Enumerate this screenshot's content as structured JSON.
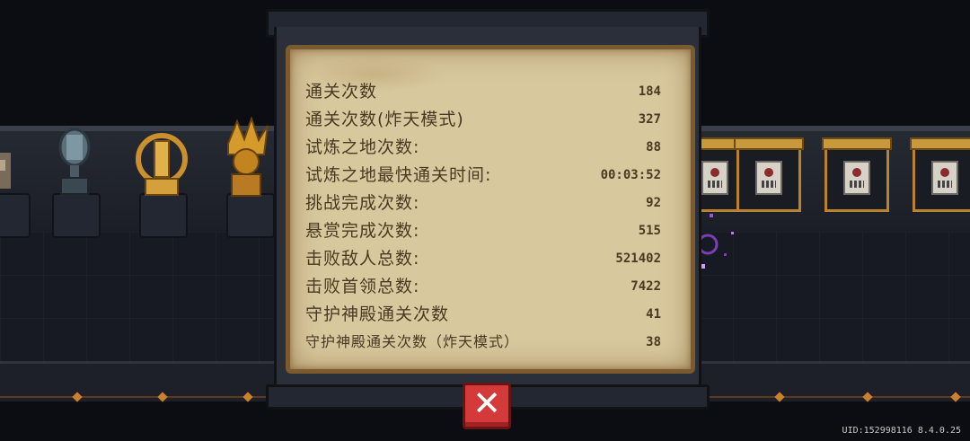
{
  "stats": [
    {
      "label": "通关次数",
      "value": "184"
    },
    {
      "label": "通关次数(炸天模式)",
      "value": "327"
    },
    {
      "label": "试炼之地次数:",
      "value": "88"
    },
    {
      "label": "试炼之地最快通关时间:",
      "value": "00:03:52"
    },
    {
      "label": "挑战完成次数:",
      "value": "92"
    },
    {
      "label": "悬赏完成次数:",
      "value": "515"
    },
    {
      "label": "击败敌人总数:",
      "value": "521402"
    },
    {
      "label": "击败首领总数:",
      "value": "7422"
    },
    {
      "label": "守护神殿通关次数",
      "value": "41"
    },
    {
      "label": "守护神殿通关次数（炸天模式）",
      "value": "38"
    }
  ],
  "close_label": "✕",
  "uid_text": "UID:152998116 8.4.0.25",
  "colors": {
    "parchment": "#d8c89e",
    "parchment_border": "#7a5a2e",
    "text": "#4a3a22",
    "close_button": "#d53a3a",
    "gold": "#c99a3b"
  }
}
